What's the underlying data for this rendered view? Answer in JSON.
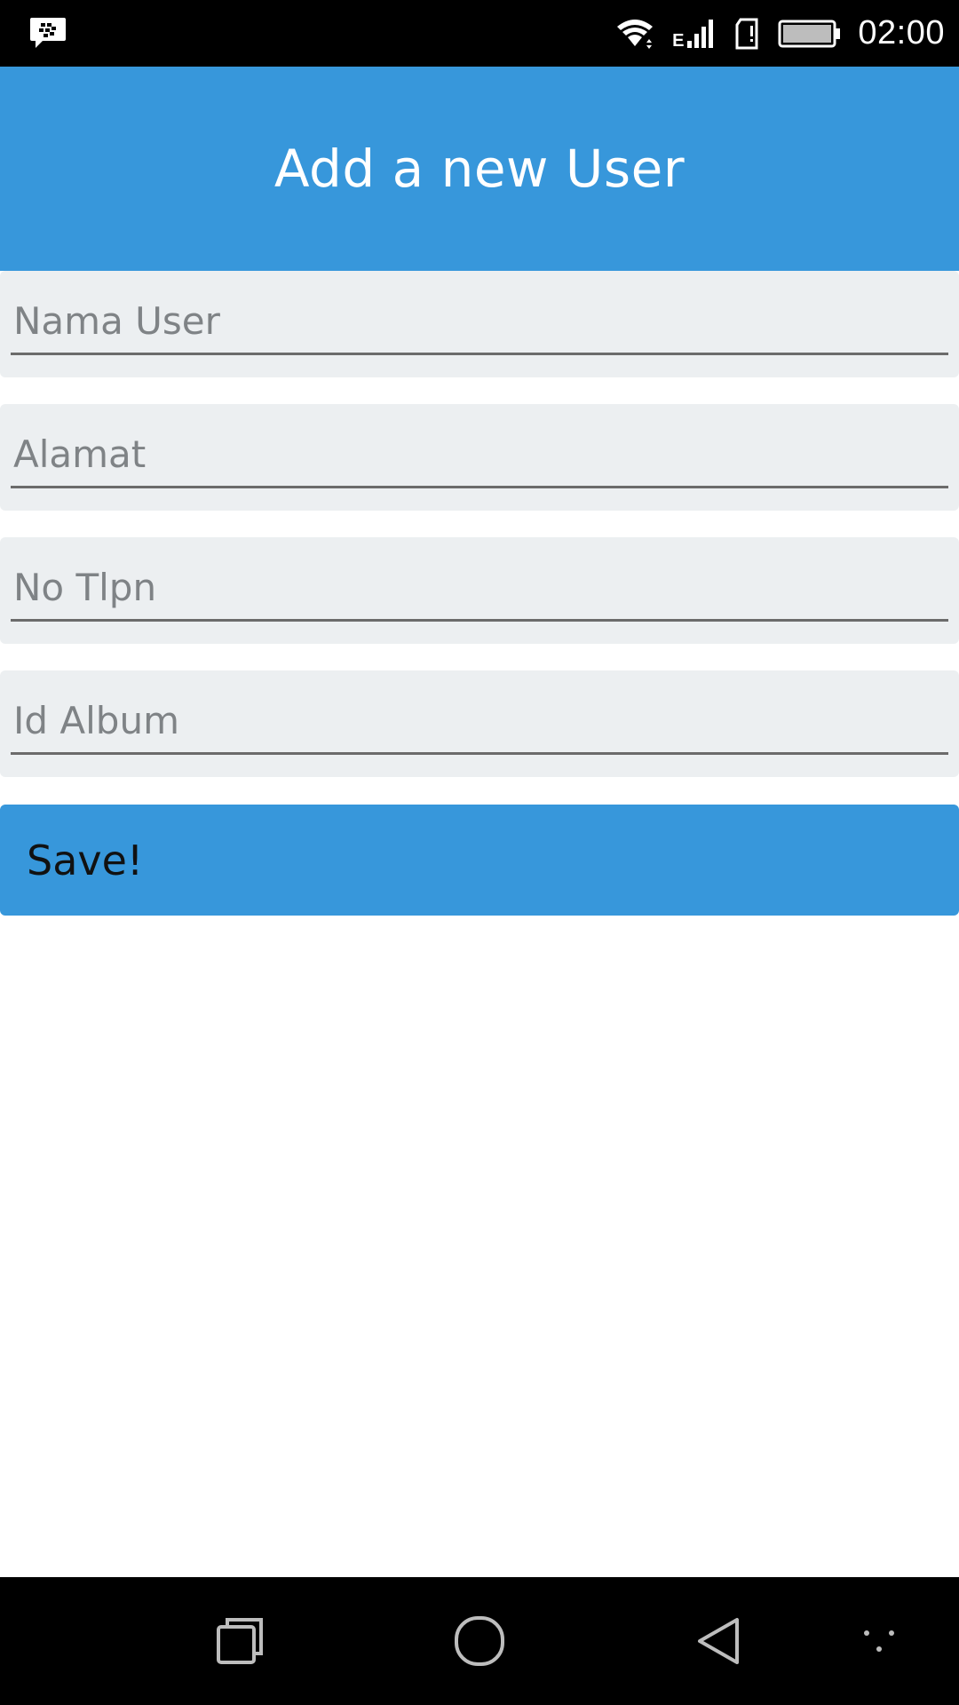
{
  "status_bar": {
    "time": "02:00",
    "network_type": "E",
    "icons": [
      "bbm-icon",
      "wifi-icon",
      "signal-icon",
      "sim-icon",
      "battery-icon"
    ]
  },
  "header": {
    "title": "Add a new User",
    "background_color": "#3797db"
  },
  "form": {
    "fields": [
      {
        "placeholder": "Nama User",
        "value": ""
      },
      {
        "placeholder": "Alamat",
        "value": ""
      },
      {
        "placeholder": "No Tlpn",
        "value": ""
      },
      {
        "placeholder": "Id Album",
        "value": ""
      }
    ],
    "save_label": "Save!",
    "button_color": "#3797db",
    "field_background": "#eceff1"
  },
  "nav_bar": {
    "icons": [
      "recent-apps-icon",
      "home-icon",
      "back-icon",
      "menu-dots-icon"
    ]
  }
}
